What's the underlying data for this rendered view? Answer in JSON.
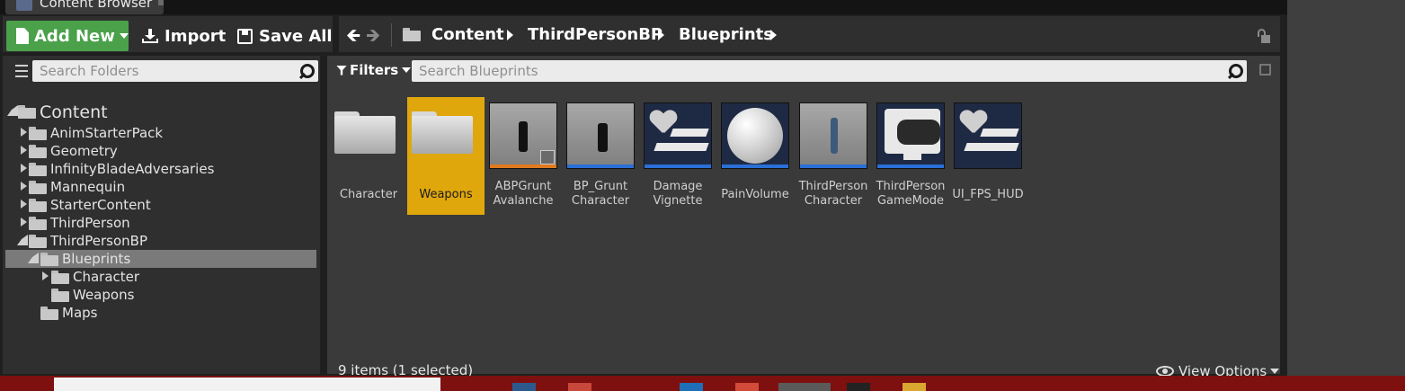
{
  "window": {
    "tab_title": "Content Browser"
  },
  "toolbar": {
    "add_new_label": "Add New",
    "import_label": "Import",
    "save_all_label": "Save All"
  },
  "path": {
    "crumbs": [
      "Content",
      "ThirdPersonBP",
      "Blueprints"
    ]
  },
  "folders": {
    "search_placeholder": "Search Folders",
    "tree": [
      {
        "label": "Content",
        "expanded": true
      },
      {
        "label": "AnimStarterPack"
      },
      {
        "label": "Geometry"
      },
      {
        "label": "InfinityBladeAdversaries"
      },
      {
        "label": "Mannequin"
      },
      {
        "label": "StarterContent"
      },
      {
        "label": "ThirdPerson"
      },
      {
        "label": "ThirdPersonBP",
        "expanded": true
      },
      {
        "label": "Blueprints",
        "expanded": true,
        "selected": true
      },
      {
        "label": "Character"
      },
      {
        "label": "Weapons"
      },
      {
        "label": "Maps"
      }
    ]
  },
  "assets": {
    "filters_label": "Filters",
    "search_placeholder": "Search Blueprints",
    "items": [
      {
        "label": "Character",
        "kind": "folder"
      },
      {
        "label": "Weapons",
        "kind": "folder",
        "selected": true
      },
      {
        "label": "ABPGrunt Avalanche",
        "kind": "anim"
      },
      {
        "label": "BP_Grunt Character",
        "kind": "blueprint"
      },
      {
        "label": "Damage Vignette",
        "kind": "widget"
      },
      {
        "label": "PainVolume",
        "kind": "blueprint"
      },
      {
        "label": "ThirdPerson Character",
        "kind": "blueprint"
      },
      {
        "label": "ThirdPerson GameMode",
        "kind": "blueprint"
      },
      {
        "label": "UI_FPS_HUD",
        "kind": "widget"
      }
    ],
    "status": "9 items (1 selected)",
    "view_options_label": "View Options"
  },
  "colors": {
    "accent_selected": "#e0a70d",
    "add_new_green": "#4aa14a",
    "anim_bar": "#e07a1f",
    "blueprint_bar": "#2a6fd6",
    "taskbar": "#7e1010"
  }
}
